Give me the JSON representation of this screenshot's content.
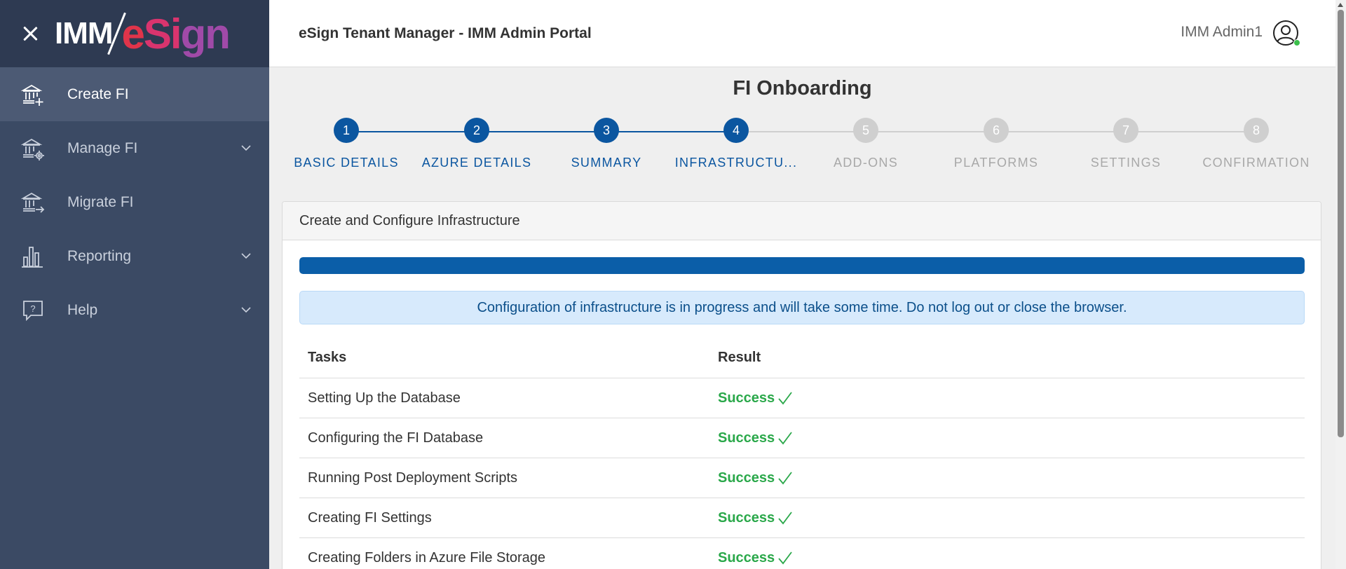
{
  "sidebar": {
    "logo": {
      "imm": "IMM",
      "esign_e": "e",
      "esign_si": "Si",
      "esign_g": "g",
      "esign_n": "n"
    },
    "items": [
      {
        "label": "Create FI",
        "icon": "bank-add-icon",
        "active": true
      },
      {
        "label": "Manage FI",
        "icon": "bank-settings-icon",
        "expandable": true
      },
      {
        "label": "Migrate FI",
        "icon": "bank-migrate-icon"
      },
      {
        "label": "Reporting",
        "icon": "bar-chart-icon",
        "expandable": true
      },
      {
        "label": "Help",
        "icon": "help-chat-icon",
        "expandable": true
      }
    ]
  },
  "header": {
    "title": "eSign Tenant Manager - IMM Admin Portal",
    "user": "IMM Admin1",
    "user_icon": "user-circle-icon",
    "status_color": "#3bbf4b"
  },
  "page": {
    "title": "FI Onboarding"
  },
  "stepper": {
    "steps": [
      {
        "number": "1",
        "label": "Basic Details",
        "state": "done"
      },
      {
        "number": "2",
        "label": "Azure Details",
        "state": "done"
      },
      {
        "number": "3",
        "label": "Summary",
        "state": "done"
      },
      {
        "number": "4",
        "label": "Infrastructu...",
        "state": "done"
      },
      {
        "number": "5",
        "label": "Add-ons",
        "state": "todo"
      },
      {
        "number": "6",
        "label": "Platforms",
        "state": "todo"
      },
      {
        "number": "7",
        "label": "Settings",
        "state": "todo"
      },
      {
        "number": "8",
        "label": "Confirmation",
        "state": "todo"
      }
    ],
    "active_color": "#0b56a0",
    "inactive_color": "#cfcfcf"
  },
  "card": {
    "title": "Create and Configure Infrastructure",
    "progress_percent": 100,
    "alert": "Configuration of infrastructure is in progress and will take some time. Do not log out or close the browser.",
    "table": {
      "headers": {
        "task": "Tasks",
        "result": "Result"
      },
      "rows": [
        {
          "task": "Setting Up the Database",
          "result": "Success"
        },
        {
          "task": "Configuring the FI Database",
          "result": "Success"
        },
        {
          "task": "Running Post Deployment Scripts",
          "result": "Success"
        },
        {
          "task": "Creating FI Settings",
          "result": "Success"
        },
        {
          "task": "Creating Folders in Azure File Storage",
          "result": "Success"
        }
      ]
    }
  }
}
